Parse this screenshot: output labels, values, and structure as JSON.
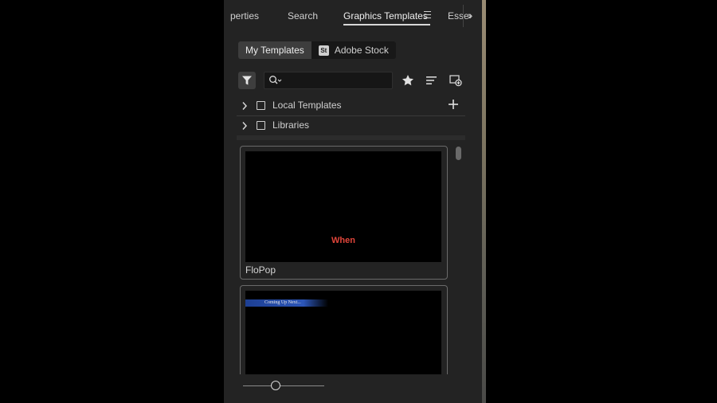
{
  "tabs": [
    {
      "label": "perties"
    },
    {
      "label": "Search"
    },
    {
      "label": "Graphics Templates",
      "active": true
    },
    {
      "label": "Esse"
    }
  ],
  "source_toggle": {
    "my_templates": "My Templates",
    "adobe_stock_badge": "St",
    "adobe_stock": "Adobe Stock"
  },
  "toolbar": {
    "search": {
      "value": "",
      "placeholder": ""
    },
    "icons": [
      "filter-icon",
      "search-icon",
      "star-icon",
      "sort-icon",
      "new-bin-icon"
    ]
  },
  "tree": [
    {
      "label": "Local Templates",
      "checked": false,
      "expanded": false
    },
    {
      "label": "Libraries",
      "checked": false,
      "expanded": false
    }
  ],
  "templates": [
    {
      "name": "FloPop",
      "preview_text": "When"
    },
    {
      "name": "",
      "preview_text": "Coming Up Next..."
    }
  ],
  "colors": {
    "panel_bg": "#232323",
    "preview_text_red": "#e0453a",
    "lower_third_blue": "#2c56b8"
  },
  "thumbnail_size": {
    "value": 0.4
  }
}
